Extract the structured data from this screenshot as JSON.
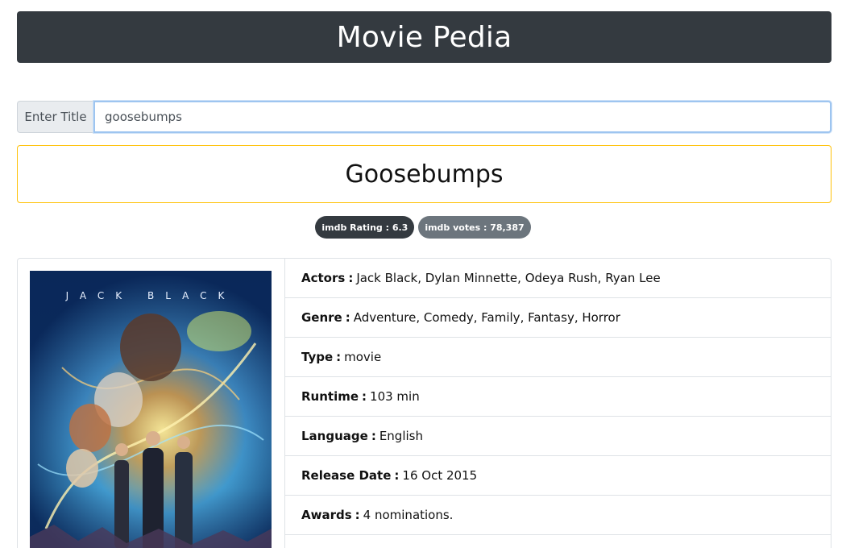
{
  "app": {
    "title": "Movie Pedia"
  },
  "search": {
    "label": "Enter Title",
    "value": "goosebumps"
  },
  "movie": {
    "title": "Goosebumps",
    "imdb_rating_text": "imdb Rating : 6.3",
    "imdb_votes_text": "imdb votes : 78,387",
    "poster_top_text": "JACK BLACK",
    "details": [
      {
        "label": "Actors",
        "value": "Jack Black, Dylan Minnette, Odeya Rush, Ryan Lee"
      },
      {
        "label": "Genre",
        "value": "Adventure, Comedy, Family, Fantasy, Horror"
      },
      {
        "label": "Type",
        "value": "movie"
      },
      {
        "label": "Runtime",
        "value": "103 min"
      },
      {
        "label": "Language",
        "value": "English"
      },
      {
        "label": "Release Date",
        "value": "16 Oct 2015"
      },
      {
        "label": "Awards",
        "value": "4 nominations."
      }
    ]
  },
  "colors": {
    "header_bg": "#343a40",
    "title_border": "#ffc107",
    "badge_dark": "#343a40",
    "badge_gray": "#6c757d"
  }
}
